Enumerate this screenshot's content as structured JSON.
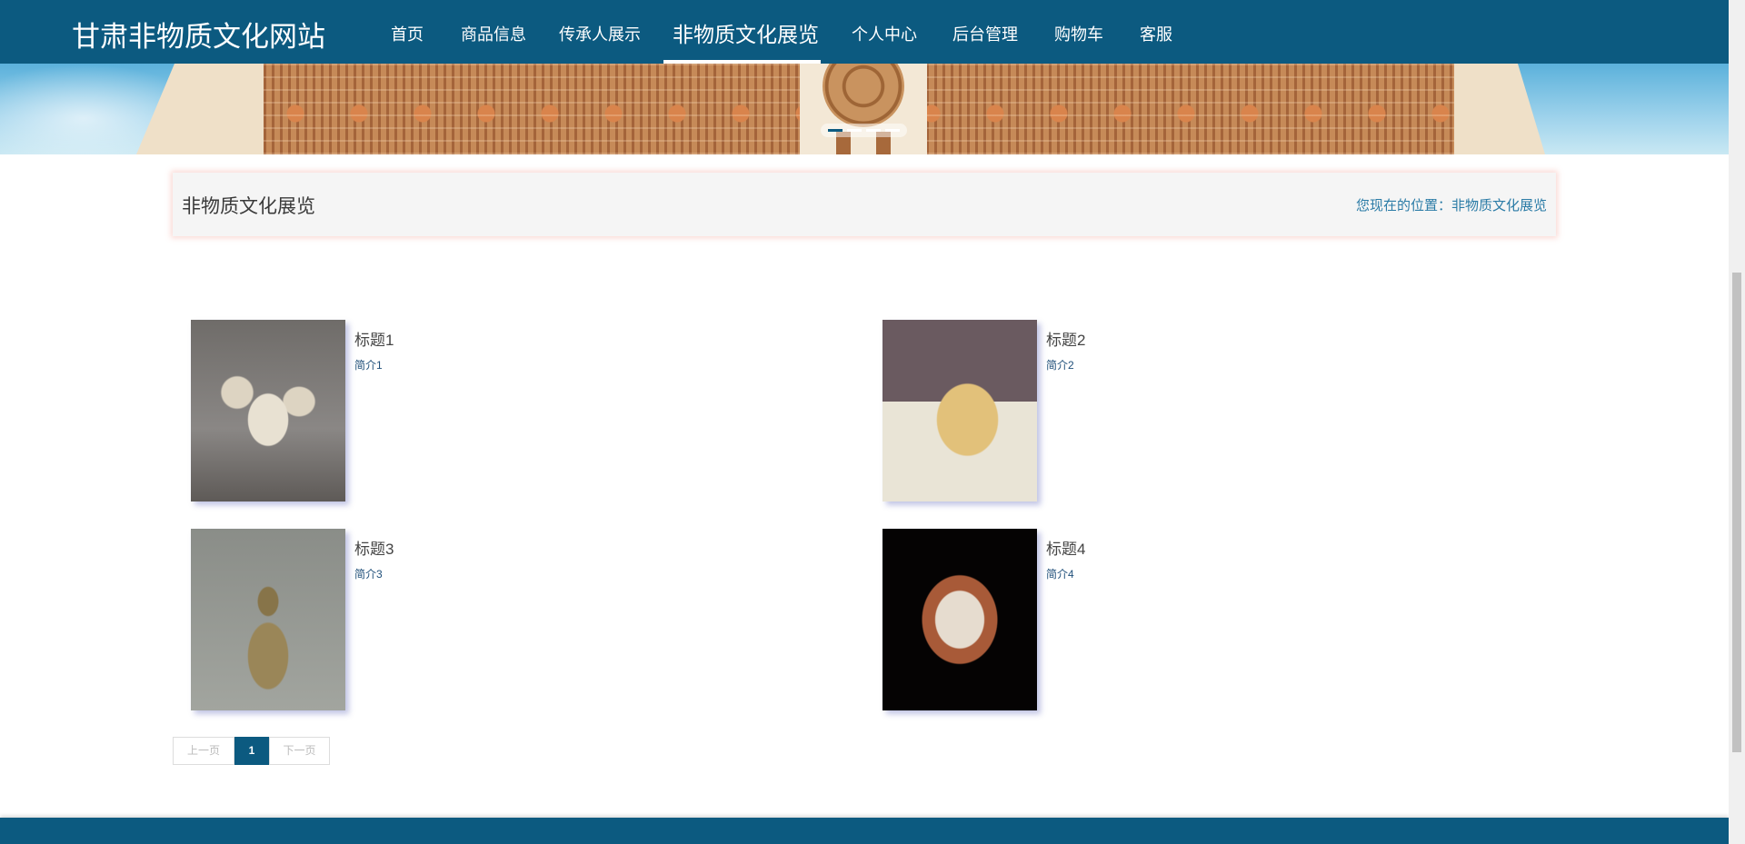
{
  "header": {
    "brand": "甘肃非物质文化网站",
    "nav": [
      "首页",
      "商品信息",
      "传承人展示",
      "非物质文化展览",
      "个人中心",
      "后台管理",
      "购物车",
      "客服"
    ],
    "active_nav": "非物质文化展览"
  },
  "breadcrumb": {
    "title": "非物质文化展览",
    "location": "您现在的位置：非物质文化展览"
  },
  "items": [
    {
      "title": "标题1",
      "desc": "简介1"
    },
    {
      "title": "标题2",
      "desc": "简介2"
    },
    {
      "title": "标题3",
      "desc": "简介3"
    },
    {
      "title": "标题4",
      "desc": "简介4"
    }
  ],
  "pager": {
    "prev": "上一页",
    "current": "1",
    "next": "下一页"
  },
  "colors": {
    "primary": "#0c5a80",
    "crumb_link": "#2a7ba6"
  },
  "carousel": {
    "slides": 4,
    "active": 1
  }
}
